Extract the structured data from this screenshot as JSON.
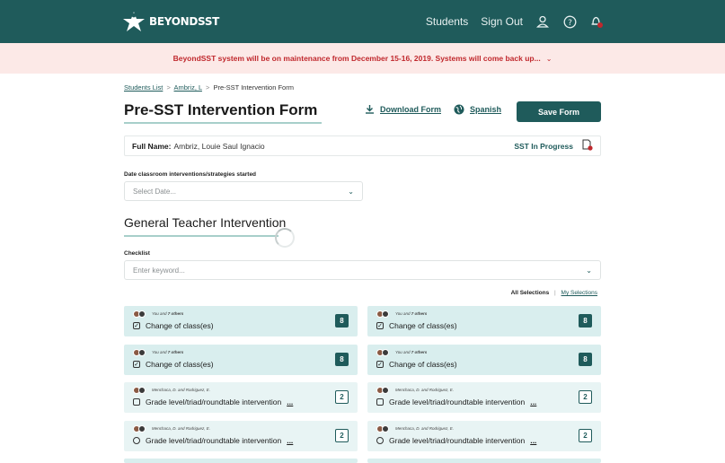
{
  "header": {
    "logo_text": "BEYONDSST",
    "nav": {
      "students": "Students",
      "signout": "Sign Out"
    },
    "icons": [
      "user-icon",
      "help-icon",
      "bell-icon"
    ],
    "notification_color": "#c0282d"
  },
  "banner": {
    "text": "BeyondSST system will be on maintenance from December 15-16, 2019. Systems will come back up..."
  },
  "breadcrumb": {
    "item1": "Students List",
    "item2": "Ambriz, L",
    "current": "Pre-SST Intervention Form",
    "sep": ">"
  },
  "page": {
    "title": "Pre-SST Intervention Form"
  },
  "actions": {
    "download": "Download Form",
    "spanish": "Spanish",
    "save": "Save Form"
  },
  "student": {
    "label": "Full Name:",
    "name": "Ambriz, Louie Saul Ignacio",
    "status": "SST In Progress"
  },
  "date_field": {
    "label": "Date classroom interventions/strategies started",
    "placeholder": "Select Date..."
  },
  "section": {
    "title": "General Teacher Intervention"
  },
  "checklist": {
    "label": "Checklist",
    "placeholder": "Enter keyword..."
  },
  "selections": {
    "all": "All Selections",
    "divider": "|",
    "mine": "My Selections"
  },
  "cards": [
    {
      "meta_prefix": "You and ",
      "meta_bold": "7 others",
      "label": "Change of class(es)",
      "more": "",
      "count": "8",
      "selected": true
    },
    {
      "meta_prefix": "You and ",
      "meta_bold": "7 others",
      "label": "Change of class(es)",
      "more": "",
      "count": "8",
      "selected": true
    },
    {
      "meta_prefix": "You and ",
      "meta_bold": "7 others",
      "label": "Change of class(es)",
      "more": "",
      "count": "8",
      "selected": true
    },
    {
      "meta_prefix": "You and ",
      "meta_bold": "7 others",
      "label": "Change of class(es)",
      "more": "",
      "count": "8",
      "selected": true
    },
    {
      "meta_prefix": "Menchaca, D. and Rodriguez, E.",
      "meta_bold": "",
      "label": "Grade level/triad/roundtable intervention",
      "more": "...",
      "count": "2",
      "selected": false
    },
    {
      "meta_prefix": "Menchaca, D. and Rodriguez, E.",
      "meta_bold": "",
      "label": "Grade level/triad/roundtable intervention",
      "more": "...",
      "count": "2",
      "selected": false
    },
    {
      "meta_prefix": "Menchaca, D. and Rodriguez, E.",
      "meta_bold": "",
      "label": "Grade level/triad/roundtable intervention",
      "more": "...",
      "count": "2",
      "selected": false
    },
    {
      "meta_prefix": "Menchaca, D. and Rodriguez, E.",
      "meta_bold": "",
      "label": "Grade level/triad/roundtable intervention",
      "more": "...",
      "count": "2",
      "selected": false
    }
  ],
  "colors": {
    "primary": "#1f5b5b",
    "banner_bg": "#fce9e7",
    "banner_text": "#c0282d",
    "card_bg": "#d9eeee"
  }
}
